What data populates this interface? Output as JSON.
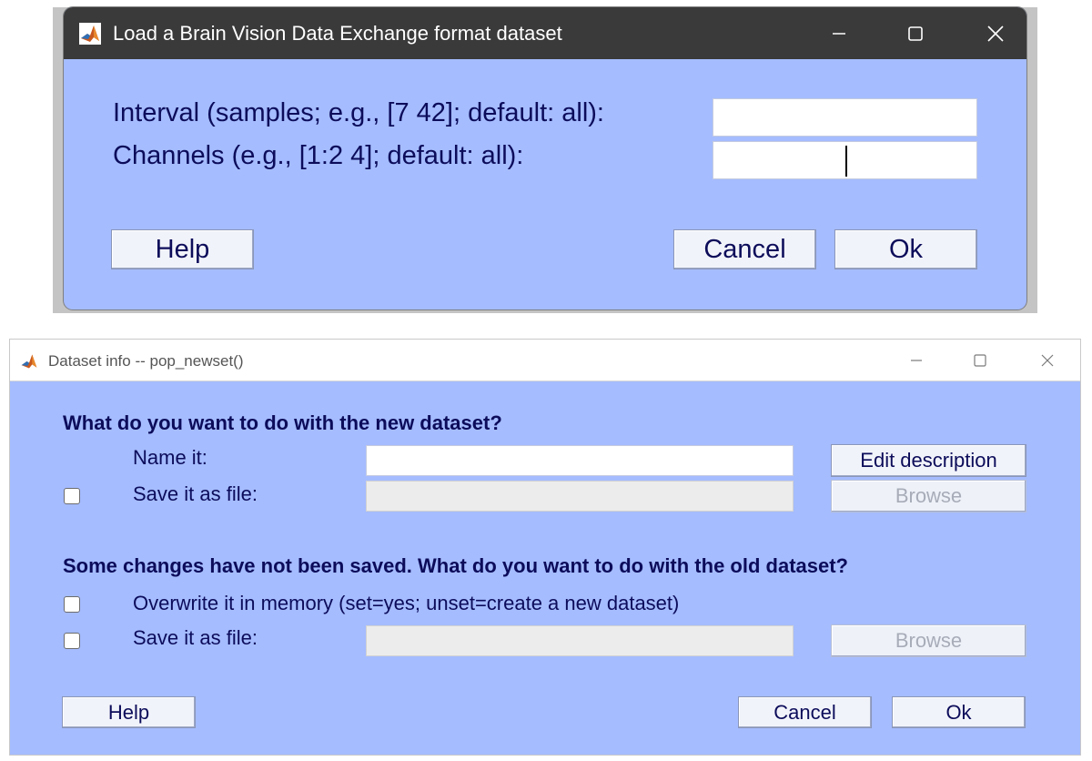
{
  "dialog_brainvision": {
    "title": "Load a Brain Vision Data Exchange format dataset",
    "interval_label": "Interval (samples; e.g., [7 42]; default: all):",
    "interval_value": "",
    "channels_label": "Channels (e.g., [1:2 4]; default: all):",
    "channels_value": "",
    "help_label": "Help",
    "cancel_label": "Cancel",
    "ok_label": "Ok"
  },
  "dialog_newset": {
    "title": "Dataset info -- pop_newset()",
    "new_dataset_heading": "What do you want to do with the new dataset?",
    "name_label": "Name it:",
    "name_value": "",
    "edit_description_label": "Edit description",
    "save_new_label": "Save it as file:",
    "save_new_checked": false,
    "browse_label": "Browse",
    "old_dataset_heading": "Some changes have not been saved. What do you want to do with the old dataset?",
    "overwrite_label": "Overwrite it in memory (set=yes; unset=create a new dataset)",
    "overwrite_checked": false,
    "save_old_label": "Save it as file:",
    "save_old_checked": false,
    "help_label": "Help",
    "cancel_label": "Cancel",
    "ok_label": "Ok"
  },
  "icons": {
    "app": "matlab-logo-icon",
    "minimize": "minimize-icon",
    "maximize": "maximize-icon",
    "close": "close-icon"
  },
  "colors": {
    "dialog_background": "#a5bcff",
    "text": "#0c0c5a",
    "dark_titlebar": "#3a3a3a"
  }
}
